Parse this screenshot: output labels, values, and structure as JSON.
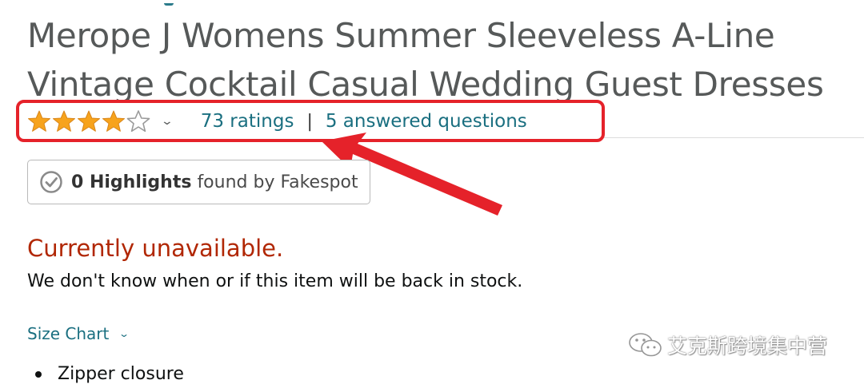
{
  "product": {
    "title": "Merope J Womens Summer Sleeveless A-Line Vintage Cocktail Casual Wedding Guest Dresses"
  },
  "rating": {
    "stars": 4,
    "out_of": 5,
    "ratings_label": "73 ratings",
    "separator": "|",
    "questions_label": "5 answered questions",
    "star_color": "#f7a31c"
  },
  "fakespot": {
    "count_label": "0 Highlights",
    "suffix": "found by Fakespot"
  },
  "availability": {
    "status": "Currently unavailable.",
    "message": "We don't know when or if this item will be back in stock.",
    "status_color": "#b12704"
  },
  "size_chart": {
    "label": "Size Chart"
  },
  "features": [
    "Zipper closure"
  ],
  "annotation": {
    "color": "#e5222a"
  },
  "watermark": {
    "text": "艾克斯跨境集中营",
    "icon": "wechat-icon"
  },
  "icons": {
    "rating_dropdown": "chevron-down-icon",
    "fakespot_check": "check-circle-icon",
    "size_chart_dropdown": "chevron-down-icon"
  }
}
